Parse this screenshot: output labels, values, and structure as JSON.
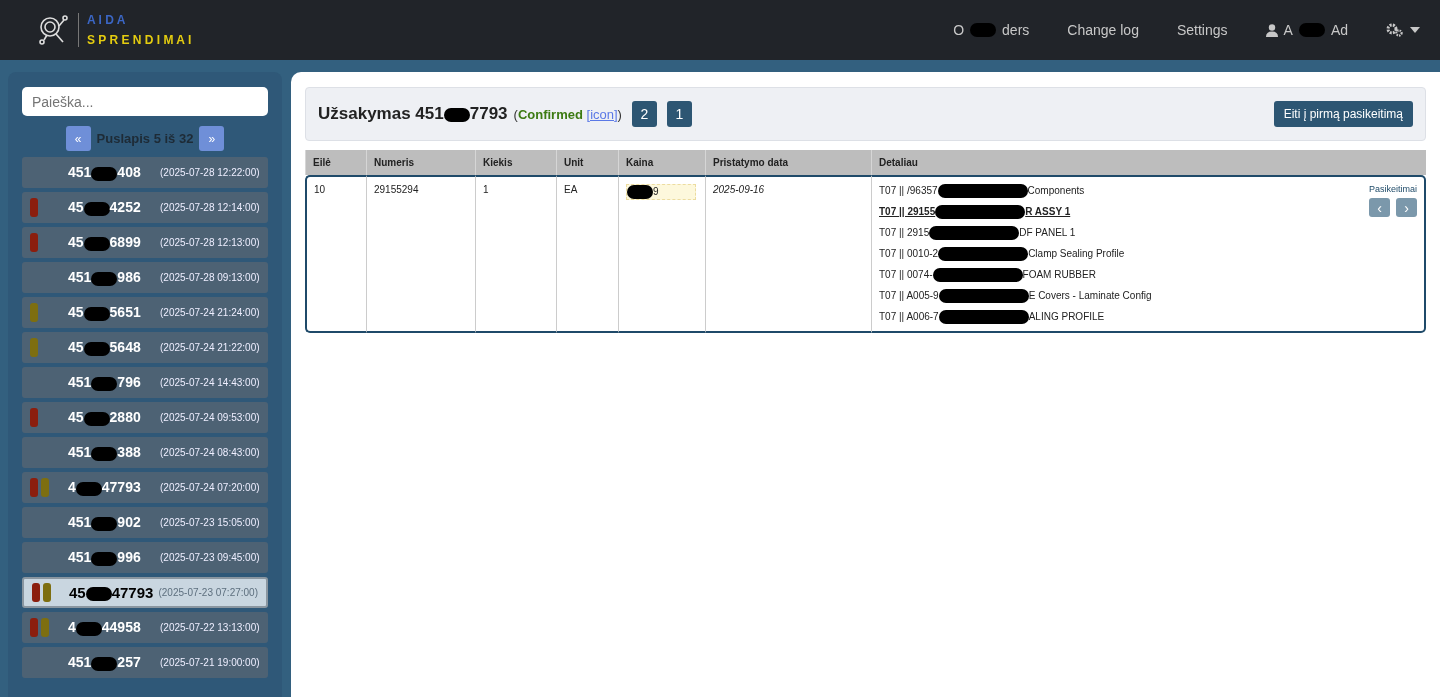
{
  "brand": {
    "line_1": "A I D A",
    "line_2": "S P R E N D I M A I"
  },
  "nav": [
    {
      "kind": "link",
      "text": {
        "before": "O",
        "after": "ders"
      }
    },
    {
      "kind": "link",
      "text": {
        "after": "Change log"
      }
    },
    {
      "kind": "link",
      "text": {
        "after": "Settings"
      }
    },
    {
      "kind": "user",
      "text": {
        "before": "A",
        "after": "Ad"
      }
    },
    {
      "kind": "menu"
    }
  ],
  "sidebar": {
    "search": {
      "placeholder": "Paieška..."
    },
    "prev": "«",
    "page_label": "Puslapis 5 iš 32",
    "next": "»",
    "orders": [
      {
        "number": {
          "before": "451",
          "after": "408"
        },
        "date": "(2025-07-28 12:22:00)",
        "selected": false
      },
      {
        "number": {
          "before": "45",
          "after": "4252"
        },
        "date": "(2025-07-28 12:14:00)",
        "selected": false,
        "tags": [
          {
            "color": "#8b1e0e"
          }
        ]
      },
      {
        "number": {
          "before": "45",
          "after": "6899"
        },
        "date": "(2025-07-28 12:13:00)",
        "selected": false,
        "tags": [
          {
            "color": "#8b1e0e"
          }
        ]
      },
      {
        "number": {
          "before": "451",
          "after": "986"
        },
        "date": "(2025-07-28 09:13:00)",
        "selected": false
      },
      {
        "number": {
          "before": "45",
          "after": "5651"
        },
        "date": "(2025-07-24 21:24:00)",
        "selected": false,
        "tags": [
          {
            "color": "#7d6e10"
          }
        ]
      },
      {
        "number": {
          "before": "45",
          "after": "5648"
        },
        "date": "(2025-07-24 21:22:00)",
        "selected": false,
        "tags": [
          {
            "color": "#7d6e10"
          }
        ]
      },
      {
        "number": {
          "before": "451",
          "after": "796"
        },
        "date": "(2025-07-24 14:43:00)",
        "selected": false
      },
      {
        "number": {
          "before": "45",
          "after": "2880"
        },
        "date": "(2025-07-24 09:53:00)",
        "selected": false,
        "tags": [
          {
            "color": "#8b1e0e"
          }
        ]
      },
      {
        "number": {
          "before": "451",
          "after": "388"
        },
        "date": "(2025-07-24 08:43:00)",
        "selected": false
      },
      {
        "number": {
          "before": "4",
          "after": "47793"
        },
        "date": "(2025-07-24 07:20:00)",
        "selected": false,
        "tags": [
          {
            "color": "#8b1e0e"
          },
          {
            "color": "#7d6e10"
          }
        ]
      },
      {
        "number": {
          "before": "451",
          "after": "902"
        },
        "date": "(2025-07-23 15:05:00)",
        "selected": false
      },
      {
        "number": {
          "before": "451",
          "after": "996"
        },
        "date": "(2025-07-23 09:45:00)",
        "selected": false
      },
      {
        "number": {
          "before": "45",
          "after": "47793"
        },
        "date": "(2025-07-23 07:27:00)",
        "selected": true,
        "tags": [
          {
            "color": "#8b1e0e"
          },
          {
            "color": "#7d6e10"
          }
        ]
      },
      {
        "number": {
          "before": "4",
          "after": "44958"
        },
        "date": "(2025-07-22 13:13:00)",
        "selected": false,
        "tags": [
          {
            "color": "#8b1e0e"
          },
          {
            "color": "#7d6e10"
          }
        ]
      },
      {
        "number": {
          "before": "451",
          "after": "257"
        },
        "date": "(2025-07-21 19:00:00)",
        "selected": false
      }
    ]
  },
  "order": {
    "title": "Užsakymas",
    "number": {
      "before": "451",
      "after": "7793"
    },
    "status_open": "(",
    "status": "Confirmed",
    "status_close": ")",
    "status_link": "[icon]",
    "badges": [
      "2",
      "1"
    ],
    "action": "Eiti į pirmą pasikeitimą"
  },
  "table": {
    "columns": [
      "Eilė",
      "Numeris",
      "Kiekis",
      "Unit",
      "Kaina",
      "Pristatymo data",
      "Detaliau"
    ],
    "rows": [
      {
        "line": "10",
        "number": "29155294",
        "quantity": "1",
        "unit": "EA",
        "price": {
          "after": "9"
        },
        "delivery_date": "2025-09-16",
        "details": [
          {
            "text": {
              "before": "T07 || /96357",
              "after": "Components"
            },
            "highlighted": false
          },
          {
            "text": {
              "before": "T07 || 29155",
              "after": "R ASSY 1"
            },
            "highlighted": true
          },
          {
            "text": {
              "before": "T07 || 2915",
              "after": "DF PANEL 1"
            },
            "highlighted": false
          },
          {
            "text": {
              "before": "T07 || 0010-2",
              "after": "Clamp Sealing Profile"
            },
            "highlighted": false
          },
          {
            "text": {
              "before": "T07 || 0074-",
              "after": "FOAM RUBBER"
            },
            "highlighted": false
          },
          {
            "text": {
              "before": "T07 || A005-9",
              "after": "E Covers - Laminate Config"
            },
            "highlighted": false
          },
          {
            "text": {
              "before": "T07 || A006-7",
              "after": "ALING PROFILE"
            },
            "highlighted": false
          }
        ],
        "changes_label": "Pasikeitimai",
        "prev": "‹",
        "next": "›"
      }
    ]
  }
}
